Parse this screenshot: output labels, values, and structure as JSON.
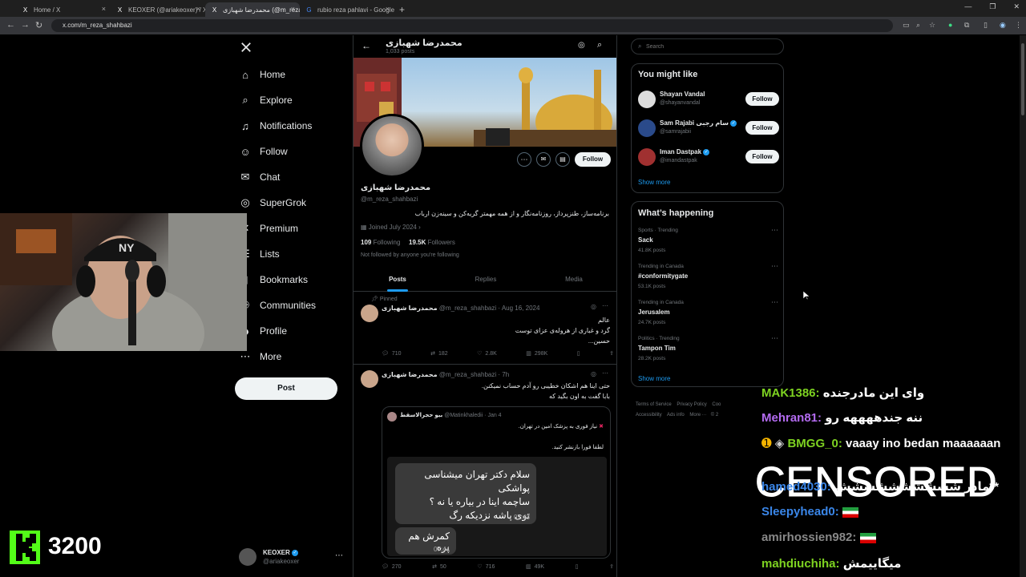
{
  "browser": {
    "tabs": [
      {
        "title": "Home / X",
        "favicon": "X"
      },
      {
        "title": "KEOXER (@ariakeoxer) / X",
        "favicon": "X"
      },
      {
        "title": "محمدرضا شهبازی (@m_reza_shahbazi",
        "favicon": "X"
      },
      {
        "title": "rubio reza pahlavi - Google Search",
        "favicon": "G"
      }
    ],
    "url": "x.com/m_reza_shahbazi"
  },
  "nav": {
    "items": [
      {
        "label": "Home",
        "icon": "home-icon",
        "glyph": "⌂"
      },
      {
        "label": "Explore",
        "icon": "search-icon",
        "glyph": "⌕"
      },
      {
        "label": "Notifications",
        "icon": "bell-icon",
        "glyph": "♫"
      },
      {
        "label": "Follow",
        "icon": "person-plus-icon",
        "glyph": "☺"
      },
      {
        "label": "Chat",
        "icon": "mail-icon",
        "glyph": "✉"
      },
      {
        "label": "SuperGrok",
        "icon": "grok-icon",
        "glyph": "◎"
      },
      {
        "label": "Premium",
        "icon": "x-premium-icon",
        "glyph": "✕"
      },
      {
        "label": "Lists",
        "icon": "list-icon",
        "glyph": "☰"
      },
      {
        "label": "Bookmarks",
        "icon": "bookmark-icon",
        "glyph": "▯"
      },
      {
        "label": "Communities",
        "icon": "communities-icon",
        "glyph": "⚇"
      },
      {
        "label": "Profile",
        "icon": "profile-icon",
        "glyph": "☻"
      },
      {
        "label": "More",
        "icon": "more-icon",
        "glyph": "⋯"
      }
    ],
    "post": "Post",
    "account": {
      "name": "KEOXER",
      "handle": "@ariakeoxer"
    }
  },
  "profile": {
    "header_name": "محمدرضا شهبازی",
    "header_posts": "1,033 posts",
    "name": "محمدرضا شهبازی",
    "handle": "@m_reza_shahbazi",
    "bio": "برنامه‌ساز، طنزپرداز، روزنامه‌نگار و از همه مهمتر گریه‌کن و سینه‌زن ارباب",
    "joined": "Joined July 2024",
    "following_count": "109",
    "following_label": "Following",
    "followers_count": "19.5K",
    "followers_label": "Followers",
    "not_followed": "Not followed by anyone you're following",
    "follow": "Follow",
    "tabs": [
      "Posts",
      "Replies",
      "Media"
    ]
  },
  "tweets": [
    {
      "pinned": "Pinned",
      "name": "محمدرضا شهبازی",
      "handle": "@m_reza_shahbazi",
      "date": "· Aug 16, 2024",
      "lines": [
        "عالم",
        "گرد و غباری از هروله‌ی عزای توست",
        "حسین..."
      ],
      "replies": "710",
      "retweets": "182",
      "likes": "2.8K",
      "views": "298K"
    },
    {
      "name": "محمدرضا شهبازی",
      "handle": "@m_reza_shahbazi",
      "date": "· 7h",
      "lines": [
        "حتی اینا هم اشکان خطیبی رو آدم حساب نمیکنن.",
        "بابا گفت به اون بگید که"
      ],
      "quote": {
        "name": "بیو حجرالاسقط",
        "handle": "@Matinkhaledii",
        "date": "· Jan 4",
        "line1": "نیاز فوری به پزشک امین در تهران.",
        "line2": "لطفا فورا بازنشر کنید.",
        "msg1": [
          "سلام دکتر تهران میشناسی پواشکی",
          "ساچمه اینا در بیاره یا نه ؟",
          "توی پاشه نزدیکه رگ"
        ],
        "time1": "07:43",
        "msg2": "کمرش هم پره",
        "time2": "07:44"
      },
      "replies": "270",
      "retweets": "50",
      "likes": "716",
      "views": "49K"
    }
  ],
  "right": {
    "search_placeholder": "Search",
    "you_might_like": "You might like",
    "suggestions": [
      {
        "name": "Shayan Vandal",
        "handle": "@shayanvandal",
        "verified": false
      },
      {
        "name": "Sam Rajabi سام رجبی",
        "handle": "@samrajabii",
        "verified": true
      },
      {
        "name": "Iman Dastpak",
        "handle": "@imandastpak",
        "verified": true
      }
    ],
    "follow": "Follow",
    "show_more": "Show more",
    "whats_happening": "What’s happening",
    "trends": [
      {
        "context": "Sports · Trending",
        "title": "Sack",
        "posts": "41.8K posts"
      },
      {
        "context": "Trending in Canada",
        "title": "#conformitygate",
        "posts": "53.1K posts"
      },
      {
        "context": "Trending in Canada",
        "title": "Jerusalem",
        "posts": "24.7K posts"
      },
      {
        "context": "Politics · Trending",
        "title": "Tampon Tim",
        "posts": "28.2K posts"
      }
    ],
    "footer": [
      "Terms of Service",
      "Privacy Policy",
      "Coo",
      "Accessibility",
      "Ads info",
      "More ···",
      "© 2"
    ]
  },
  "stream": {
    "counter": "3200",
    "censored": "CENSORED",
    "chat": [
      {
        "user": "MAK1386:",
        "msg": "وای این مادرجنده",
        "color": "#7ed321"
      },
      {
        "user": "Mehran81:",
        "msg": "ننه جندههههه رو",
        "color": "#b36bf0"
      },
      {
        "user": "BMGG_0:",
        "msg": "vaaay ino bedan maaaaaan",
        "color": "#7ed321"
      },
      {
        "user": "hamed4030:",
        "msg": "مادر شششششششششش**",
        "color": "#3a86e8"
      },
      {
        "user": "Sleepyhead0:",
        "msg": "",
        "color": "#3a86e8"
      },
      {
        "user": "amirhossien982:",
        "msg": "",
        "color": "#888888"
      },
      {
        "user": "mahdiuchiha:",
        "msg": "میگاییمش",
        "color": "#7ed321"
      }
    ]
  }
}
